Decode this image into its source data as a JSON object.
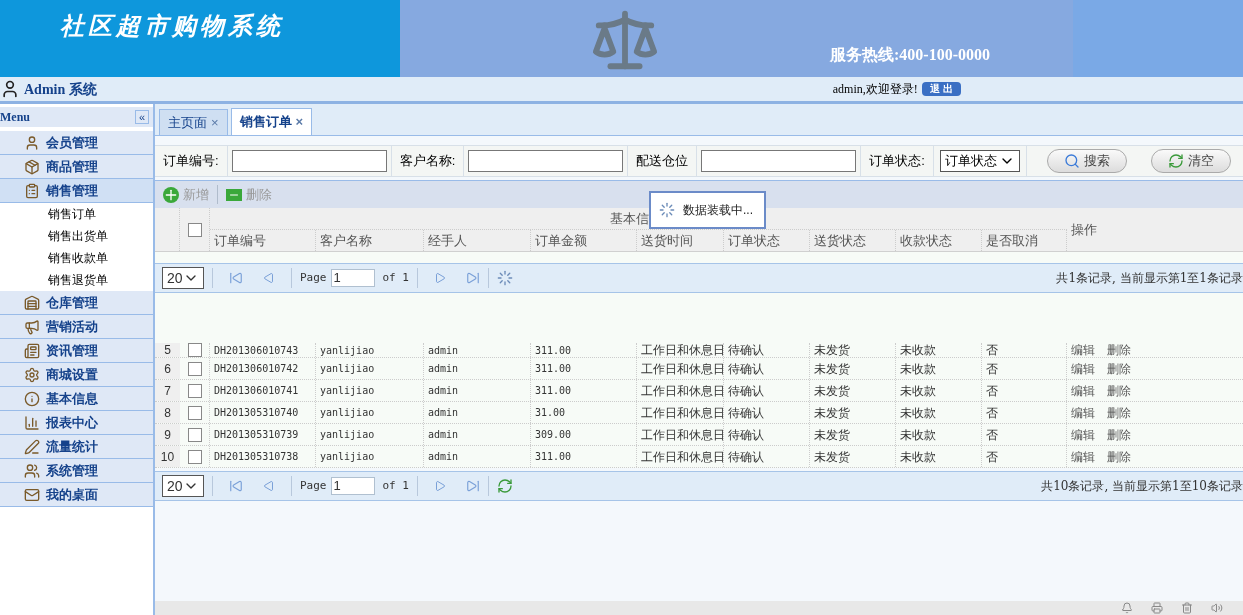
{
  "banner": {
    "title": "社区超市购物系统",
    "hotline": "服务热线:400-100-0000"
  },
  "header": {
    "user_title": "Admin 系统",
    "welcome": "admin,欢迎登录!",
    "logout": "退 出"
  },
  "sidebar": {
    "title": "Menu",
    "collapse": "«",
    "items": [
      {
        "label": "会员管理",
        "expanded": false
      },
      {
        "label": "商品管理",
        "expanded": false
      },
      {
        "label": "销售管理",
        "expanded": true,
        "children": [
          {
            "label": "销售订单"
          },
          {
            "label": "销售出货单"
          },
          {
            "label": "销售收款单"
          },
          {
            "label": "销售退货单"
          }
        ]
      },
      {
        "label": "仓库管理",
        "expanded": false
      },
      {
        "label": "营销活动",
        "expanded": false
      },
      {
        "label": "资讯管理",
        "expanded": false
      },
      {
        "label": "商城设置",
        "expanded": false
      },
      {
        "label": "基本信息",
        "expanded": false
      },
      {
        "label": "报表中心",
        "expanded": false
      },
      {
        "label": "流量统计",
        "expanded": false
      },
      {
        "label": "系统管理",
        "expanded": false
      },
      {
        "label": "我的桌面",
        "expanded": false
      }
    ]
  },
  "tabs": [
    {
      "label": "主页面",
      "close": "×",
      "selected": false
    },
    {
      "label": "销售订单",
      "close": "×",
      "selected": true
    }
  ],
  "search": {
    "fields": [
      {
        "label": "订单编号:",
        "kind": "text"
      },
      {
        "label": "客户名称:",
        "kind": "text"
      },
      {
        "label": "配送仓位",
        "kind": "text"
      },
      {
        "label": "订单状态:",
        "kind": "select",
        "value": "订单状态"
      }
    ],
    "buttons": [
      {
        "label": "搜索"
      },
      {
        "label": "清空"
      }
    ]
  },
  "toolbar": [
    {
      "label": "新增",
      "disabled": true
    },
    {
      "label": "删除",
      "disabled": true
    }
  ],
  "loading": "数据装载中...",
  "grid": {
    "select_all_checked": false,
    "group_header": "基本信",
    "action_header": "操作",
    "columns": [
      "订单编号",
      "客户名称",
      "经手人",
      "订单金额",
      "送货时间",
      "订单状态",
      "送货状态",
      "收款状态",
      "是否取消"
    ]
  },
  "pager_top": {
    "page_size": "20",
    "page_label": "Page",
    "page": "1",
    "of": "of 1",
    "summary": "共1条记录, 当前显示第1至1条记录"
  },
  "rows": [
    {
      "num": "5",
      "checked": false,
      "cells": [
        "DH201306010743",
        "yanlijiao",
        "admin",
        "311.00",
        "工作日和休息日",
        "待确认",
        "未发货",
        "未收款",
        "否"
      ],
      "actions": [
        "编辑",
        "删除"
      ]
    },
    {
      "num": "6",
      "checked": false,
      "cells": [
        "DH201306010742",
        "yanlijiao",
        "admin",
        "311.00",
        "工作日和休息日",
        "待确认",
        "未发货",
        "未收款",
        "否"
      ],
      "actions": [
        "编辑",
        "删除"
      ]
    },
    {
      "num": "7",
      "checked": false,
      "cells": [
        "DH201306010741",
        "yanlijiao",
        "admin",
        "311.00",
        "工作日和休息日",
        "待确认",
        "未发货",
        "未收款",
        "否"
      ],
      "actions": [
        "编辑",
        "删除"
      ]
    },
    {
      "num": "8",
      "checked": false,
      "cells": [
        "DH201305310740",
        "yanlijiao",
        "admin",
        "31.00",
        "工作日和休息日",
        "待确认",
        "未发货",
        "未收款",
        "否"
      ],
      "actions": [
        "编辑",
        "删除"
      ]
    },
    {
      "num": "9",
      "checked": false,
      "cells": [
        "DH201305310739",
        "yanlijiao",
        "admin",
        "309.00",
        "工作日和休息日",
        "待确认",
        "未发货",
        "未收款",
        "否"
      ],
      "actions": [
        "编辑",
        "删除"
      ]
    },
    {
      "num": "10",
      "checked": false,
      "cells": [
        "DH201305310738",
        "yanlijiao",
        "admin",
        "311.00",
        "工作日和休息日",
        "待确认",
        "未发货",
        "未收款",
        "否"
      ],
      "actions": [
        "编辑",
        "删除"
      ]
    }
  ],
  "pager_bottom": {
    "page_size": "20",
    "page_label": "Page",
    "page": "1",
    "of": "of 1",
    "summary": "共10条记录, 当前显示第1至10条记录"
  }
}
